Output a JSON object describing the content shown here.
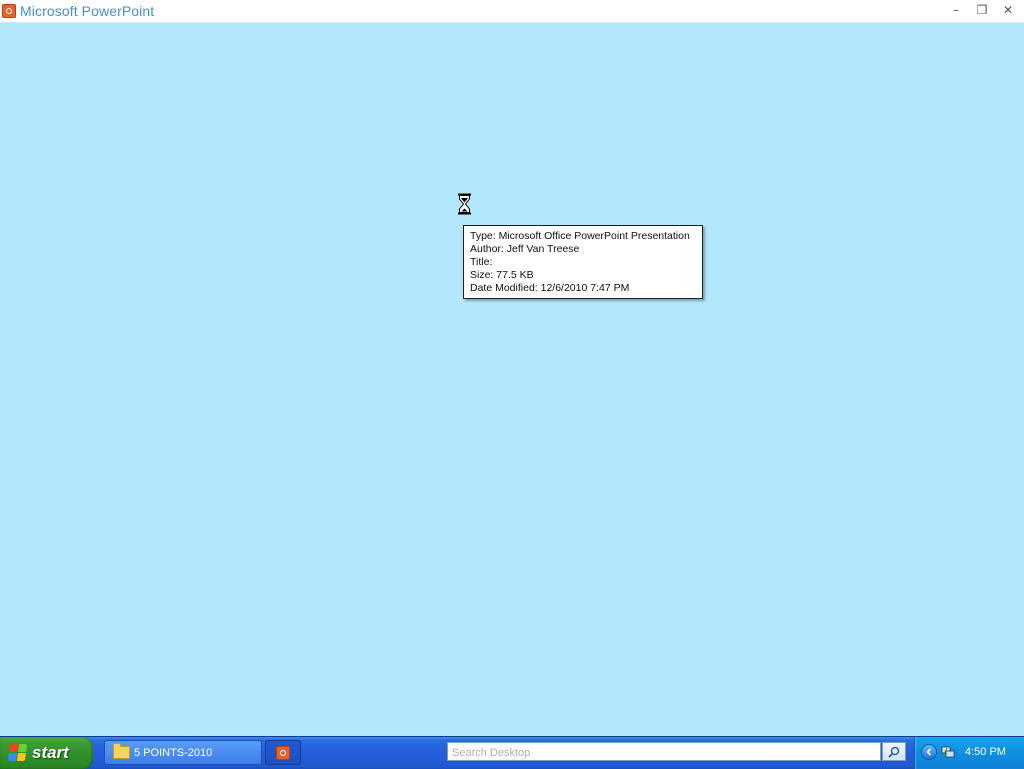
{
  "window": {
    "title": "Microsoft PowerPoint",
    "controls": {
      "minimize": "–",
      "restore": "❐",
      "close": "✕"
    }
  },
  "tooltip": {
    "lines": [
      "Type: Microsoft Office PowerPoint Presentation",
      "Author: Jeff Van Treese",
      "Title:",
      "Size: 77.5 KB",
      "Date Modified: 12/6/2010 7:47 PM"
    ]
  },
  "cursor": {
    "icon": "hourglass-icon"
  },
  "taskbar": {
    "start_label": "start",
    "tasks": [
      {
        "label": "5 POINTS-2010",
        "icon": "folder-icon"
      },
      {
        "label": "",
        "icon": "powerpoint-icon"
      }
    ],
    "search": {
      "placeholder": "Search Desktop",
      "value": ""
    },
    "tray": {
      "clock": "4:50 PM"
    }
  },
  "colors": {
    "background": "#b3e7fb",
    "title_text": "#4a8fc8",
    "taskbar": "#245edc",
    "start_button": "#3c9f35",
    "tray": "#0f8ee0"
  }
}
